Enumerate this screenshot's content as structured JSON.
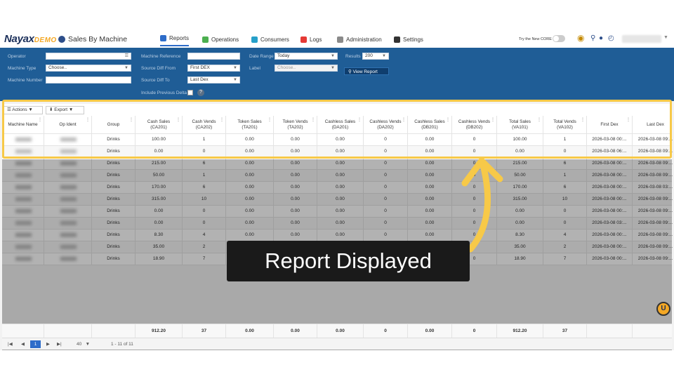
{
  "topnav": {
    "logo_main": "Nayax",
    "logo_sub": "DEMO",
    "page_title": "Sales By Machine",
    "items": [
      {
        "label": "Reports",
        "color": "#2d6cc9"
      },
      {
        "label": "Operations",
        "color": "#4caf50"
      },
      {
        "label": "Consumers",
        "color": "#26a0c9"
      },
      {
        "label": "Logs",
        "color": "#e53935"
      },
      {
        "label": "Administration",
        "color": "#8a8a8a"
      },
      {
        "label": "Settings",
        "color": "#333333"
      }
    ],
    "try_core": "Try the New CORE"
  },
  "filters": {
    "operator_label": "Operator",
    "machine_type_label": "Machine Type",
    "machine_type_value": "Choose..",
    "machine_number_label": "Machine Number",
    "machine_reference_label": "Machine Reference",
    "source_diff_from_label": "Source Diff From",
    "source_diff_from_value": "First DEX",
    "source_diff_to_label": "Source Diff To",
    "source_diff_to_value": "Last Dex",
    "include_prev_label": "Include Previous Delta",
    "date_range_label": "Date Range",
    "date_range_value": "Today",
    "label_label": "Label",
    "label_value": "Choose..",
    "results_label": "Results",
    "results_value": "200",
    "view_report": "View Report"
  },
  "toolbar": {
    "actions": "Actions",
    "export": "Export"
  },
  "table": {
    "headers": [
      [
        "Machine Name",
        ""
      ],
      [
        "Op Ident",
        ""
      ],
      [
        "Group",
        ""
      ],
      [
        "Cash Sales",
        "(CA201)"
      ],
      [
        "Cash Vends",
        "(CA202)"
      ],
      [
        "Token Sales",
        "(TA201)"
      ],
      [
        "Token Vends",
        "(TA202)"
      ],
      [
        "Cashless Sales",
        "(DA201)"
      ],
      [
        "Cashless Vends",
        "(DA202)"
      ],
      [
        "Cashless Sales",
        "(DB201)"
      ],
      [
        "Cashless Vends",
        "(DB202)"
      ],
      [
        "Total Sales",
        "(VA101)"
      ],
      [
        "Total Vends",
        "(VA102)"
      ],
      [
        "First Dex",
        ""
      ],
      [
        "Last Dex",
        ""
      ]
    ],
    "rows": [
      [
        "Drinks",
        "100.00",
        "1",
        "0.00",
        "0.00",
        "0.00",
        "0",
        "0.00",
        "0",
        "100.00",
        "1",
        "2026-03-08 00:...",
        "2026-03-08 09:..."
      ],
      [
        "Drinks",
        "0.00",
        "0",
        "0.00",
        "0.00",
        "0.00",
        "0",
        "0.00",
        "0",
        "0.00",
        "0",
        "2026-03-08 06:...",
        "2026-03-08 09:..."
      ],
      [
        "Drinks",
        "215.00",
        "6",
        "0.00",
        "0.00",
        "0.00",
        "0",
        "0.00",
        "0",
        "215.00",
        "6",
        "2026-03-08 00:...",
        "2026-03-08 09:..."
      ],
      [
        "Drinks",
        "50.00",
        "1",
        "0.00",
        "0.00",
        "0.00",
        "0",
        "0.00",
        "0",
        "50.00",
        "1",
        "2026-03-08 00:...",
        "2026-03-08 09:..."
      ],
      [
        "Drinks",
        "170.00",
        "6",
        "0.00",
        "0.00",
        "0.00",
        "0",
        "0.00",
        "0",
        "170.00",
        "6",
        "2026-03-08 00:...",
        "2026-03-08 03:..."
      ],
      [
        "Drinks",
        "315.00",
        "10",
        "0.00",
        "0.00",
        "0.00",
        "0",
        "0.00",
        "0",
        "315.00",
        "10",
        "2026-03-08 00:...",
        "2026-03-08 09:..."
      ],
      [
        "Drinks",
        "0.00",
        "0",
        "0.00",
        "0.00",
        "0.00",
        "0",
        "0.00",
        "0",
        "0.00",
        "0",
        "2026-03-08 00:...",
        "2026-03-08 09:..."
      ],
      [
        "Drinks",
        "0.00",
        "0",
        "0.00",
        "0.00",
        "0.00",
        "0",
        "0.00",
        "0",
        "0.00",
        "0",
        "2026-03-08 03:...",
        "2026-03-08 09:..."
      ],
      [
        "Drinks",
        "8.30",
        "4",
        "0.00",
        "0.00",
        "0.00",
        "0",
        "0.00",
        "0",
        "8.30",
        "4",
        "2026-03-08 00:...",
        "2026-03-08 09:..."
      ],
      [
        "Drinks",
        "35.00",
        "2",
        "0.00",
        "0.00",
        "0.00",
        "0",
        "0.00",
        "0",
        "35.00",
        "2",
        "2026-03-08 00:...",
        "2026-03-08 09:..."
      ],
      [
        "Drinks",
        "18.90",
        "7",
        "0.00",
        "0.00",
        "0.00",
        "0",
        "0.00",
        "0",
        "18.90",
        "7",
        "2026-03-08 00:...",
        "2026-03-08 09:..."
      ]
    ],
    "totals": [
      "",
      "",
      "",
      "912.20",
      "37",
      "0.00",
      "0.00",
      "0.00",
      "0",
      "0.00",
      "0",
      "912.20",
      "37",
      "",
      ""
    ]
  },
  "pager": {
    "current": "1",
    "page_size": "40",
    "range": "1 - 11 of 11"
  },
  "callout": "Report Displayed"
}
